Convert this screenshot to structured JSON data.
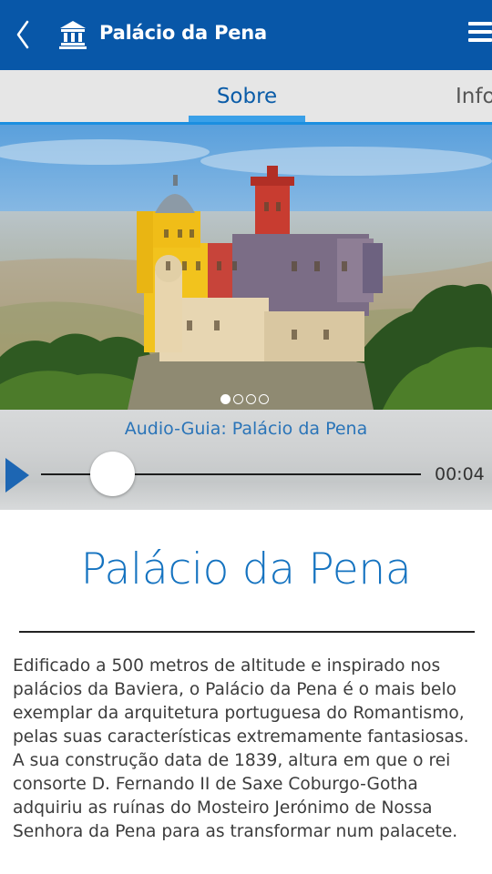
{
  "header": {
    "title": "Palácio da Pena",
    "back_icon": "chevron-left-icon",
    "logo_icon": "monument-icon",
    "menu_icon": "hamburger-menu-icon",
    "background_color": "#0857a8"
  },
  "tabs": [
    {
      "label": "Sobre",
      "active": true
    },
    {
      "label": "Info",
      "active": false
    }
  ],
  "carousel": {
    "current_index": 1,
    "total": 4,
    "image_subject": "Palácio da Pena"
  },
  "audio": {
    "title": "Audio-Guia: Palácio da Pena",
    "time": "00:04",
    "play_icon": "play-icon"
  },
  "content": {
    "title": "Palácio da Pena",
    "body": "Edificado a 500 metros de altitude e inspirado nos palácios da Baviera, o Palácio da Pena é o mais belo exemplar da arquitetura portuguesa do Romantismo, pelas suas características extremamente fantasiosas. A sua construção data de 1839, altura em que o rei consorte D. Fernando II de Saxe Coburgo-Gotha adquiriu as ruínas do Mosteiro Jerónimo de Nossa Senhora da Pena para as transformar num palacete."
  },
  "colors": {
    "accent": "#1573c0",
    "tab_highlight": "#3aa0e8",
    "audio_title": "#2a74b8"
  }
}
